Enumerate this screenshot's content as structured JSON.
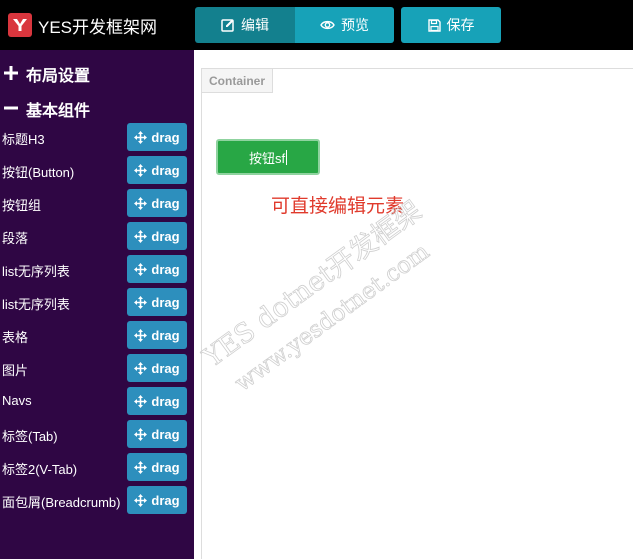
{
  "brand": {
    "name": "YES开发框架网",
    "logo_icon": "yes-logo-icon"
  },
  "toolbar": {
    "edit_label": "编辑",
    "preview_label": "预览",
    "save_label": "保存"
  },
  "sidebar": {
    "layout_title": "布局设置",
    "basic_title": "基本组件",
    "drag_label": "drag",
    "items": [
      {
        "label": "标题H3"
      },
      {
        "label": "按钮(Button)"
      },
      {
        "label": "按钮组"
      },
      {
        "label": "段落"
      },
      {
        "label": "list无序列表"
      },
      {
        "label": "list无序列表"
      },
      {
        "label": "表格"
      },
      {
        "label": "图片"
      },
      {
        "label": "Navs"
      },
      {
        "label": "标签(Tab)"
      },
      {
        "label": "标签2(V-Tab)"
      },
      {
        "label": "面包屑(Breadcrumb)"
      }
    ]
  },
  "canvas": {
    "container_label": "Container",
    "button_text": "按钮sf",
    "hint_text": "可直接编辑元素"
  },
  "watermark": {
    "line1": "YES dotnet开发框架",
    "line2": "www.yesdotnet.com"
  },
  "colors": {
    "topbar": "#000000",
    "sidebar": "#2f0644",
    "toolbar_active": "#13808e",
    "toolbar": "#17a2b8",
    "drag": "#2d8fbd",
    "green": "#28a745",
    "hint": "#e03a2c"
  }
}
